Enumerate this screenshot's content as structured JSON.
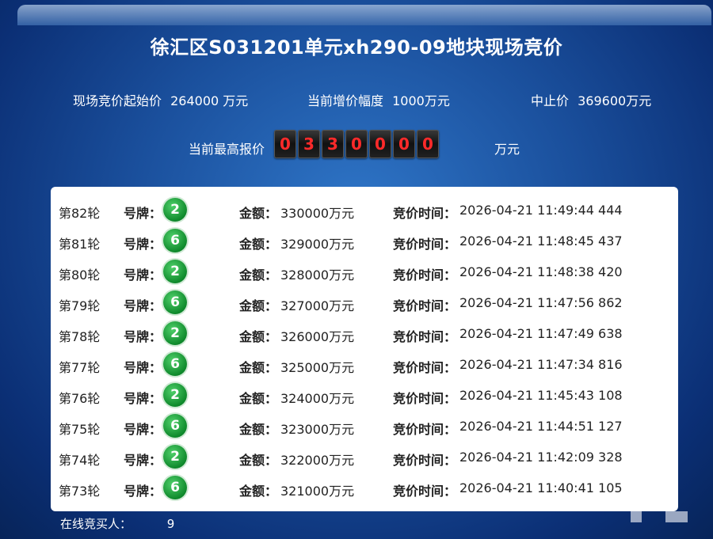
{
  "title": "徐汇区S031201单元xh290-09地块现场竞价",
  "info": {
    "start_label": "现场竞价起始价",
    "start_value": "264000 万元",
    "increment_label": "当前增价幅度",
    "increment_value": "1000万元",
    "stop_label": "中止价",
    "stop_value": "369600万元"
  },
  "current_price": {
    "label": "当前最高报价",
    "digits": [
      "0",
      "3",
      "3",
      "0",
      "0",
      "0",
      "0"
    ],
    "unit": "万元"
  },
  "bids": [
    {
      "round": "第82轮",
      "plate_label": "号牌：",
      "plate": "2",
      "amount_label": "金额：",
      "amount": "330000万元",
      "time_label": "竞价时间：",
      "time": "2026-04-21 11:49:44 444"
    },
    {
      "round": "第81轮",
      "plate_label": "号牌：",
      "plate": "6",
      "amount_label": "金额：",
      "amount": "329000万元",
      "time_label": "竞价时间：",
      "time": "2026-04-21 11:48:45 437"
    },
    {
      "round": "第80轮",
      "plate_label": "号牌：",
      "plate": "2",
      "amount_label": "金额：",
      "amount": "328000万元",
      "time_label": "竞价时间：",
      "time": "2026-04-21 11:48:38 420"
    },
    {
      "round": "第79轮",
      "plate_label": "号牌：",
      "plate": "6",
      "amount_label": "金额：",
      "amount": "327000万元",
      "time_label": "竞价时间：",
      "time": "2026-04-21 11:47:56 862"
    },
    {
      "round": "第78轮",
      "plate_label": "号牌：",
      "plate": "2",
      "amount_label": "金额：",
      "amount": "326000万元",
      "time_label": "竞价时间：",
      "time": "2026-04-21 11:47:49 638"
    },
    {
      "round": "第77轮",
      "plate_label": "号牌：",
      "plate": "6",
      "amount_label": "金额：",
      "amount": "325000万元",
      "time_label": "竞价时间：",
      "time": "2026-04-21 11:47:34 816"
    },
    {
      "round": "第76轮",
      "plate_label": "号牌：",
      "plate": "2",
      "amount_label": "金额：",
      "amount": "324000万元",
      "time_label": "竞价时间：",
      "time": "2026-04-21 11:45:43 108"
    },
    {
      "round": "第75轮",
      "plate_label": "号牌：",
      "plate": "6",
      "amount_label": "金额：",
      "amount": "323000万元",
      "time_label": "竞价时间：",
      "time": "2026-04-21 11:44:51 127"
    },
    {
      "round": "第74轮",
      "plate_label": "号牌：",
      "plate": "2",
      "amount_label": "金额：",
      "amount": "322000万元",
      "time_label": "竞价时间：",
      "time": "2026-04-21 11:42:09 328"
    },
    {
      "round": "第73轮",
      "plate_label": "号牌：",
      "plate": "6",
      "amount_label": "金额：",
      "amount": "321000万元",
      "time_label": "竞价时间：",
      "time": "2026-04-21 11:40:41 105"
    }
  ],
  "online": {
    "label": "在线竞买人：",
    "count": "9"
  },
  "colors": {
    "background": "#1a4f9c",
    "digit_text": "#ff2a2a",
    "badge": "#0f8a2c"
  }
}
